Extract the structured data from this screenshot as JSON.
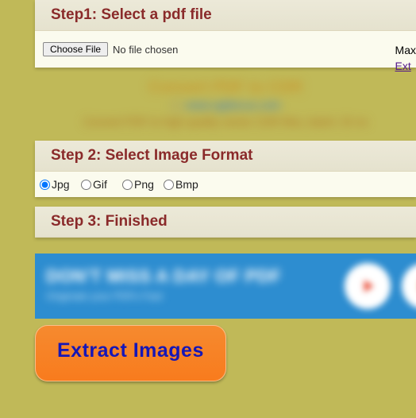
{
  "step1": {
    "heading": "Step1: Select a pdf file",
    "chooseFileButton": "Choose File",
    "noFileText": "No file chosen",
    "sideLine1": "Max",
    "sideLink": "Ext"
  },
  "ad1": {
    "line1": "Convert PDF to CDR",
    "line2": "www.sgldocus.com",
    "line3": "Convert PDF to high quality vector CDR files, batch. Et no"
  },
  "step2": {
    "heading": "Step 2: Select Image Format",
    "options": {
      "jpg": "Jpg",
      "gif": "Gif",
      "png": "Png",
      "bmp": "Bmp"
    }
  },
  "step3": {
    "heading": "Step 3: Finished"
  },
  "banner": {
    "line1": "DON'T MISS A DAY OF PDF",
    "line2": "Originate your PDFs Fast"
  },
  "action": {
    "extractButton": "Extract Images"
  }
}
